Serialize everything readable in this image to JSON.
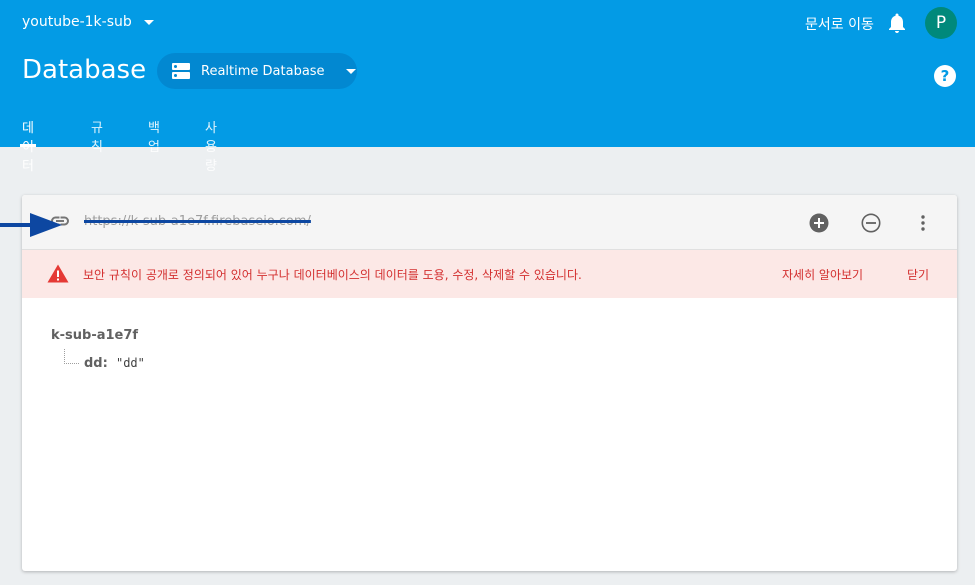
{
  "header": {
    "project_name": "youtube-1k-sub",
    "docs_link": "문서로 이동",
    "avatar_letter": "P",
    "page_title": "Database",
    "db_selector_label": "Realtime Database",
    "help_glyph": "?",
    "tabs": [
      {
        "label": "데이터",
        "active": true
      },
      {
        "label": "규칙",
        "active": false
      },
      {
        "label": "백업",
        "active": false
      },
      {
        "label": "사용량",
        "active": false
      }
    ]
  },
  "data_panel": {
    "url": "https://k-sub-a1e7f.firebaseio.com/",
    "icons": [
      "link-icon",
      "add-circle-icon",
      "remove-circle-icon",
      "more-vert-icon"
    ],
    "warning": {
      "text": "보안 규칙이 공개로 정의되어 있어 누구나 데이터베이스의 데이터를 도용, 수정, 삭제할 수 있습니다.",
      "learn_more": "자세히 알아보기",
      "close": "닫기",
      "icon": "warning-icon",
      "color": "#d32f2f"
    },
    "tree": {
      "root": "k-sub-a1e7f",
      "children": [
        {
          "key": "dd",
          "separator": ":",
          "value": "\"dd\""
        }
      ]
    }
  },
  "colors": {
    "brand": "#039be5",
    "selector": "#0288d1",
    "avatar": "#00897b",
    "annotation_arrow": "#0d47a1"
  }
}
